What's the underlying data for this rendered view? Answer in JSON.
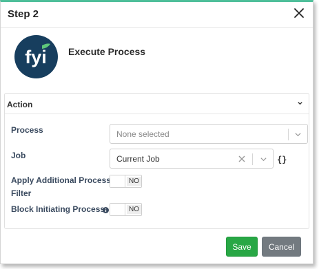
{
  "dialog": {
    "title": "Step 2"
  },
  "hero": {
    "logo_text": "fyi",
    "title": "Execute Process"
  },
  "panel": {
    "title": "Action",
    "fields": {
      "process": {
        "label": "Process",
        "placeholder": "None selected"
      },
      "job": {
        "label": "Job",
        "value": "Current Job",
        "expression_button": "{}"
      },
      "apply_filter": {
        "label": "Apply Additional Process Filter",
        "state": "NO"
      },
      "block_initiating": {
        "label": "Block Initiating Process",
        "state": "NO"
      }
    }
  },
  "footer": {
    "save_label": "Save",
    "cancel_label": "Cancel"
  },
  "colors": {
    "accent_top": "#4fbf9a",
    "logo_bg": "#173e5e",
    "logo_leaf": "#5ec77a",
    "save": "#28a745",
    "cancel": "#737a80"
  }
}
